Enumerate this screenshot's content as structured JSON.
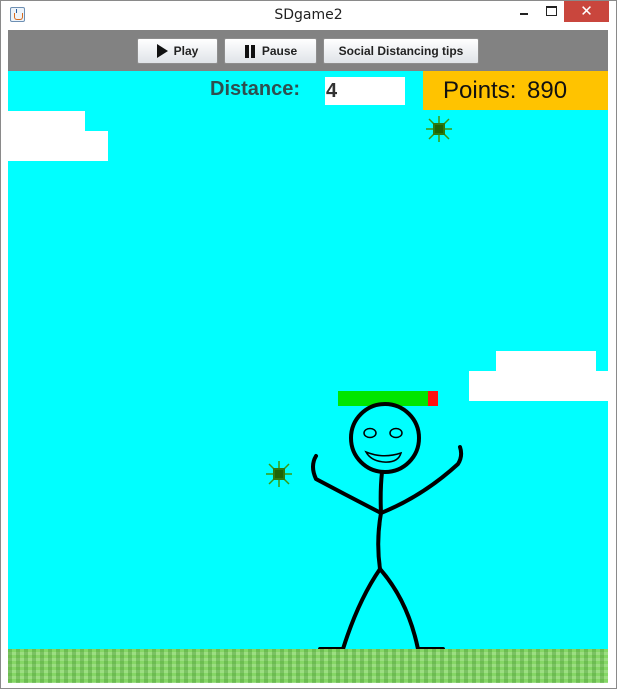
{
  "window": {
    "title": "SDgame2",
    "close_symbol": "✕"
  },
  "toolbar": {
    "play_label": "Play",
    "pause_label": "Pause",
    "tips_label": "Social Distancing tips"
  },
  "hud": {
    "distance_label": "Distance:",
    "distance_value": "4",
    "points_label": "Points:",
    "points_value": "890"
  },
  "player": {
    "health_fraction": 0.9
  },
  "colors": {
    "sky": "#00ffff",
    "points_box": "#ffc300",
    "health_full": "#00e600",
    "health_empty": "#ff1010",
    "grass": "#86d766",
    "virus": "#2f7a10"
  },
  "icons": {
    "play": "play-icon",
    "pause": "pause-icon",
    "app": "java-cup-icon",
    "enemy": "virus-icon"
  }
}
